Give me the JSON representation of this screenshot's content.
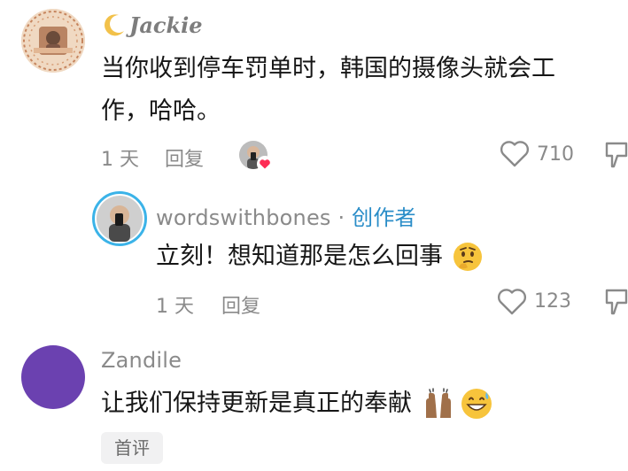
{
  "comments": [
    {
      "username": "Jackie",
      "username_prefix_icon": "crescent-moon-icon",
      "text_line1": "当你收到停车罚单时，韩国的摄像头就会工",
      "text_line2": "作，哈哈。",
      "time": "1 天",
      "reply_label": "回复",
      "likes": "710",
      "liked_by_creator": true
    },
    {
      "username": "wordswithbones",
      "separator": " · ",
      "badge": "创作者",
      "text": "立刻！想知道那是怎么回事",
      "emoji": "thinking-face-icon",
      "time": "1 天",
      "reply_label": "回复",
      "likes": "123"
    },
    {
      "username": "Zandile",
      "text": "让我们保持更新是真正的奉献",
      "emojis": [
        "raising-hands-icon",
        "grinning-sweat-icon"
      ],
      "tag": "首评",
      "avatar_color": "#6b41b0"
    }
  ],
  "colors": {
    "text": "#161616",
    "muted": "#8a8a8a",
    "creator": "#2a8dc8",
    "heart_badge": "#fe2c55"
  }
}
